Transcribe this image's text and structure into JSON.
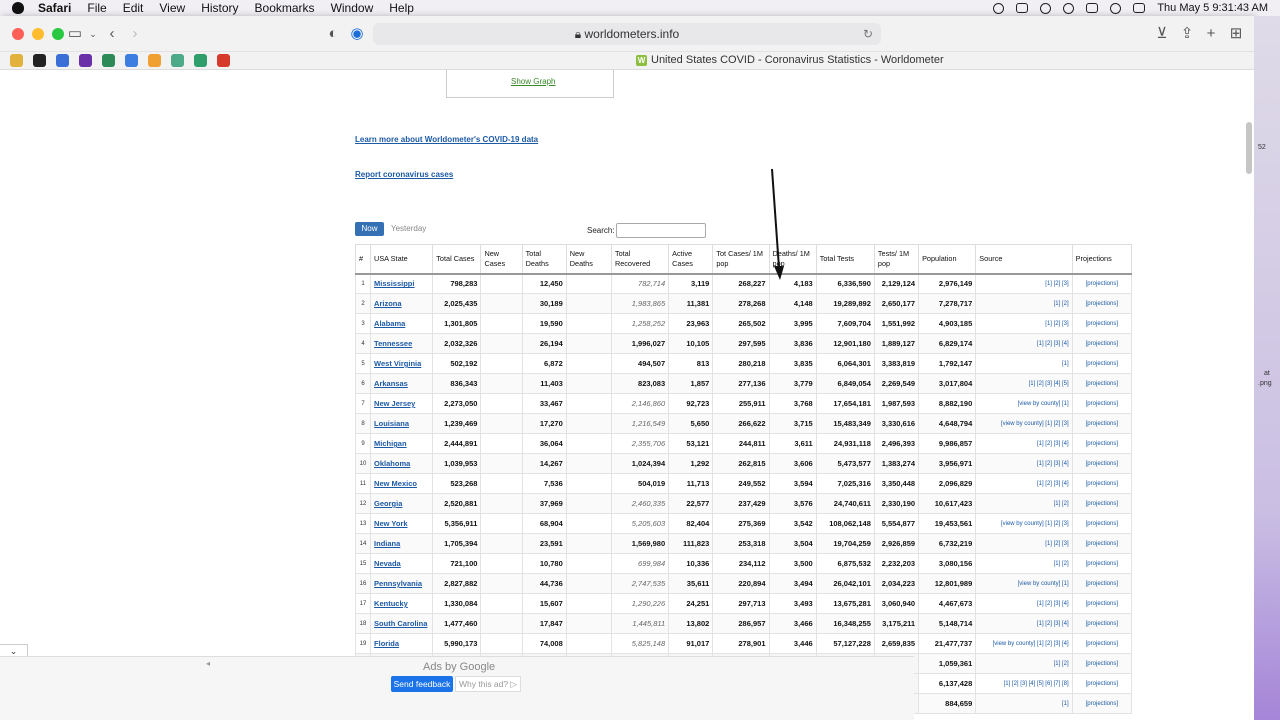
{
  "menubar": {
    "app": "Safari",
    "items": [
      "File",
      "Edit",
      "View",
      "History",
      "Bookmarks",
      "Window",
      "Help"
    ],
    "clock": "Thu May 5  9:31:43 AM"
  },
  "browser": {
    "address": "worldometers.info",
    "tab_title": "United States COVID - Coronavirus Statistics - Worldometer",
    "tab_icon_letter": "W",
    "bookmark_colors": [
      "#e3b23c",
      "#222222",
      "#3b6fd8",
      "#6b2fa8",
      "#2b8a55",
      "#3b7de0",
      "#f0a030",
      "#4caa88",
      "#2f9e6a",
      "#d63a2a"
    ]
  },
  "page": {
    "show_graph": "Show Graph",
    "learn_more": "Learn more about Worldometer's COVID-19 data",
    "report_cases": "Report coronavirus cases",
    "btn_now": "Now",
    "btn_yesterday": "Yesterday",
    "search_label": "Search:"
  },
  "table": {
    "headers": [
      "#",
      "USA State",
      "Total Cases",
      "New Cases",
      "Total Deaths",
      "New Deaths",
      "Total Recovered",
      "Active Cases",
      "Tot Cases/ 1M pop",
      "Deaths/ 1M pop",
      "Total Tests",
      "Tests/ 1M pop",
      "Population",
      "Source",
      "Projections"
    ],
    "rows": [
      {
        "n": "1",
        "state": "Mississippi",
        "cases": "798,283",
        "new_cases": "",
        "deaths": "12,450",
        "new_deaths": "",
        "recovered": "782,714",
        "rec_italic": true,
        "active": "3,119",
        "cases_1m": "268,227",
        "deaths_1m": "4,183",
        "tests": "6,336,590",
        "tests_1m": "2,129,124",
        "population": "2,976,149",
        "source": "[1] [2] [3]",
        "proj": "[projections]"
      },
      {
        "n": "2",
        "state": "Arizona",
        "cases": "2,025,435",
        "new_cases": "",
        "deaths": "30,189",
        "new_deaths": "",
        "recovered": "1,983,865",
        "rec_italic": true,
        "active": "11,381",
        "cases_1m": "278,268",
        "deaths_1m": "4,148",
        "tests": "19,289,892",
        "tests_1m": "2,650,177",
        "population": "7,278,717",
        "source": "[1] [2]",
        "proj": "[projections]"
      },
      {
        "n": "3",
        "state": "Alabama",
        "cases": "1,301,805",
        "new_cases": "",
        "deaths": "19,590",
        "new_deaths": "",
        "recovered": "1,258,252",
        "rec_italic": true,
        "active": "23,963",
        "cases_1m": "265,502",
        "deaths_1m": "3,995",
        "tests": "7,609,704",
        "tests_1m": "1,551,992",
        "population": "4,903,185",
        "source": "[1] [2] [3]",
        "proj": "[projections]"
      },
      {
        "n": "4",
        "state": "Tennessee",
        "cases": "2,032,326",
        "new_cases": "",
        "deaths": "26,194",
        "new_deaths": "",
        "recovered": "1,996,027",
        "rec_italic": false,
        "active": "10,105",
        "cases_1m": "297,595",
        "deaths_1m": "3,836",
        "tests": "12,901,180",
        "tests_1m": "1,889,127",
        "population": "6,829,174",
        "source": "[1] [2] [3] [4]",
        "proj": "[projections]"
      },
      {
        "n": "5",
        "state": "West Virginia",
        "cases": "502,192",
        "new_cases": "",
        "deaths": "6,872",
        "new_deaths": "",
        "recovered": "494,507",
        "rec_italic": false,
        "active": "813",
        "cases_1m": "280,218",
        "deaths_1m": "3,835",
        "tests": "6,064,301",
        "tests_1m": "3,383,819",
        "population": "1,792,147",
        "source": "[1]",
        "proj": "[projections]"
      },
      {
        "n": "6",
        "state": "Arkansas",
        "cases": "836,343",
        "new_cases": "",
        "deaths": "11,403",
        "new_deaths": "",
        "recovered": "823,083",
        "rec_italic": false,
        "active": "1,857",
        "cases_1m": "277,136",
        "deaths_1m": "3,779",
        "tests": "6,849,054",
        "tests_1m": "2,269,549",
        "population": "3,017,804",
        "source": "[1] [2] [3] [4] [5]",
        "proj": "[projections]"
      },
      {
        "n": "7",
        "state": "New Jersey",
        "cases": "2,273,050",
        "new_cases": "",
        "deaths": "33,467",
        "new_deaths": "",
        "recovered": "2,146,860",
        "rec_italic": true,
        "active": "92,723",
        "cases_1m": "255,911",
        "deaths_1m": "3,768",
        "tests": "17,654,181",
        "tests_1m": "1,987,593",
        "population": "8,882,190",
        "source": "[view by county] [1]",
        "proj": "[projections]"
      },
      {
        "n": "8",
        "state": "Louisiana",
        "cases": "1,239,469",
        "new_cases": "",
        "deaths": "17,270",
        "new_deaths": "",
        "recovered": "1,216,549",
        "rec_italic": true,
        "active": "5,650",
        "cases_1m": "266,622",
        "deaths_1m": "3,715",
        "tests": "15,483,349",
        "tests_1m": "3,330,616",
        "population": "4,648,794",
        "source": "[view by county] [1] [2] [3]",
        "proj": "[projections]"
      },
      {
        "n": "9",
        "state": "Michigan",
        "cases": "2,444,891",
        "new_cases": "",
        "deaths": "36,064",
        "new_deaths": "",
        "recovered": "2,355,706",
        "rec_italic": true,
        "active": "53,121",
        "cases_1m": "244,811",
        "deaths_1m": "3,611",
        "tests": "24,931,118",
        "tests_1m": "2,496,393",
        "population": "9,986,857",
        "source": "[1] [2] [3] [4]",
        "proj": "[projections]"
      },
      {
        "n": "10",
        "state": "Oklahoma",
        "cases": "1,039,953",
        "new_cases": "",
        "deaths": "14,267",
        "new_deaths": "",
        "recovered": "1,024,394",
        "rec_italic": false,
        "active": "1,292",
        "cases_1m": "262,815",
        "deaths_1m": "3,606",
        "tests": "5,473,577",
        "tests_1m": "1,383,274",
        "population": "3,956,971",
        "source": "[1] [2] [3] [4]",
        "proj": "[projections]"
      },
      {
        "n": "11",
        "state": "New Mexico",
        "cases": "523,268",
        "new_cases": "",
        "deaths": "7,536",
        "new_deaths": "",
        "recovered": "504,019",
        "rec_italic": false,
        "active": "11,713",
        "cases_1m": "249,552",
        "deaths_1m": "3,594",
        "tests": "7,025,316",
        "tests_1m": "3,350,448",
        "population": "2,096,829",
        "source": "[1] [2] [3] [4]",
        "proj": "[projections]"
      },
      {
        "n": "12",
        "state": "Georgia",
        "cases": "2,520,881",
        "new_cases": "",
        "deaths": "37,969",
        "new_deaths": "",
        "recovered": "2,460,335",
        "rec_italic": true,
        "active": "22,577",
        "cases_1m": "237,429",
        "deaths_1m": "3,576",
        "tests": "24,740,611",
        "tests_1m": "2,330,190",
        "population": "10,617,423",
        "source": "[1] [2]",
        "proj": "[projections]"
      },
      {
        "n": "13",
        "state": "New York",
        "cases": "5,356,911",
        "new_cases": "",
        "deaths": "68,904",
        "new_deaths": "",
        "recovered": "5,205,603",
        "rec_italic": true,
        "active": "82,404",
        "cases_1m": "275,369",
        "deaths_1m": "3,542",
        "tests": "108,062,148",
        "tests_1m": "5,554,877",
        "population": "19,453,561",
        "source": "[view by county] [1] [2] [3]",
        "proj": "[projections]"
      },
      {
        "n": "14",
        "state": "Indiana",
        "cases": "1,705,394",
        "new_cases": "",
        "deaths": "23,591",
        "new_deaths": "",
        "recovered": "1,569,980",
        "rec_italic": false,
        "active": "111,823",
        "cases_1m": "253,318",
        "deaths_1m": "3,504",
        "tests": "19,704,259",
        "tests_1m": "2,926,859",
        "population": "6,732,219",
        "source": "[1] [2] [3]",
        "proj": "[projections]"
      },
      {
        "n": "15",
        "state": "Nevada",
        "cases": "721,100",
        "new_cases": "",
        "deaths": "10,780",
        "new_deaths": "",
        "recovered": "699,984",
        "rec_italic": true,
        "active": "10,336",
        "cases_1m": "234,112",
        "deaths_1m": "3,500",
        "tests": "6,875,532",
        "tests_1m": "2,232,203",
        "population": "3,080,156",
        "source": "[1] [2]",
        "proj": "[projections]"
      },
      {
        "n": "16",
        "state": "Pennsylvania",
        "cases": "2,827,882",
        "new_cases": "",
        "deaths": "44,736",
        "new_deaths": "",
        "recovered": "2,747,535",
        "rec_italic": true,
        "active": "35,611",
        "cases_1m": "220,894",
        "deaths_1m": "3,494",
        "tests": "26,042,101",
        "tests_1m": "2,034,223",
        "population": "12,801,989",
        "source": "[view by county] [1]",
        "proj": "[projections]"
      },
      {
        "n": "17",
        "state": "Kentucky",
        "cases": "1,330,084",
        "new_cases": "",
        "deaths": "15,607",
        "new_deaths": "",
        "recovered": "1,290,226",
        "rec_italic": true,
        "active": "24,251",
        "cases_1m": "297,713",
        "deaths_1m": "3,493",
        "tests": "13,675,281",
        "tests_1m": "3,060,940",
        "population": "4,467,673",
        "source": "[1] [2] [3] [4]",
        "proj": "[projections]"
      },
      {
        "n": "18",
        "state": "South Carolina",
        "cases": "1,477,460",
        "new_cases": "",
        "deaths": "17,847",
        "new_deaths": "",
        "recovered": "1,445,811",
        "rec_italic": true,
        "active": "13,802",
        "cases_1m": "286,957",
        "deaths_1m": "3,466",
        "tests": "16,348,255",
        "tests_1m": "3,175,211",
        "population": "5,148,714",
        "source": "[1] [2] [3] [4]",
        "proj": "[projections]"
      },
      {
        "n": "19",
        "state": "Florida",
        "cases": "5,990,173",
        "new_cases": "",
        "deaths": "74,008",
        "new_deaths": "",
        "recovered": "5,825,148",
        "rec_italic": true,
        "active": "91,017",
        "cases_1m": "278,901",
        "deaths_1m": "3,446",
        "tests": "57,127,228",
        "tests_1m": "2,659,835",
        "population": "21,477,737",
        "source": "[view by county] [1] [2] [3] [4]",
        "proj": "[projections]"
      },
      {
        "n": "",
        "state": "",
        "cases": "",
        "new_cases": "",
        "deaths": "",
        "new_deaths": "",
        "recovered": "",
        "rec_italic": false,
        "active": "",
        "cases_1m": "",
        "deaths_1m": "",
        "tests": "",
        "tests_1m": "",
        "population": "1,059,361",
        "source": "[1] [2]",
        "proj": "[projections]"
      },
      {
        "n": "",
        "state": "",
        "cases": "",
        "new_cases": "",
        "deaths": "",
        "new_deaths": "",
        "recovered": "",
        "rec_italic": false,
        "active": "",
        "cases_1m": "",
        "deaths_1m": "",
        "tests": "",
        "tests_1m": "",
        "population": "6,137,428",
        "source": "[1] [2] [3] [4] [5] [6] [7] [8]",
        "proj": "[projections]"
      },
      {
        "n": "",
        "state": "",
        "cases": "",
        "new_cases": "",
        "deaths": "",
        "new_deaths": "",
        "recovered": "",
        "rec_italic": false,
        "active": "",
        "cases_1m": "",
        "deaths_1m": "",
        "tests": "",
        "tests_1m": "",
        "population": "884,659",
        "source": "[1]",
        "proj": "[projections]"
      }
    ]
  },
  "ads": {
    "ads_by": "Ads by Google",
    "send_feedback": "Send feedback",
    "why_ad": "Why this ad? ▷"
  },
  "desktop": {
    "side_text_1": "52",
    "side_text_2": "at",
    "side_text_3": ".png"
  }
}
